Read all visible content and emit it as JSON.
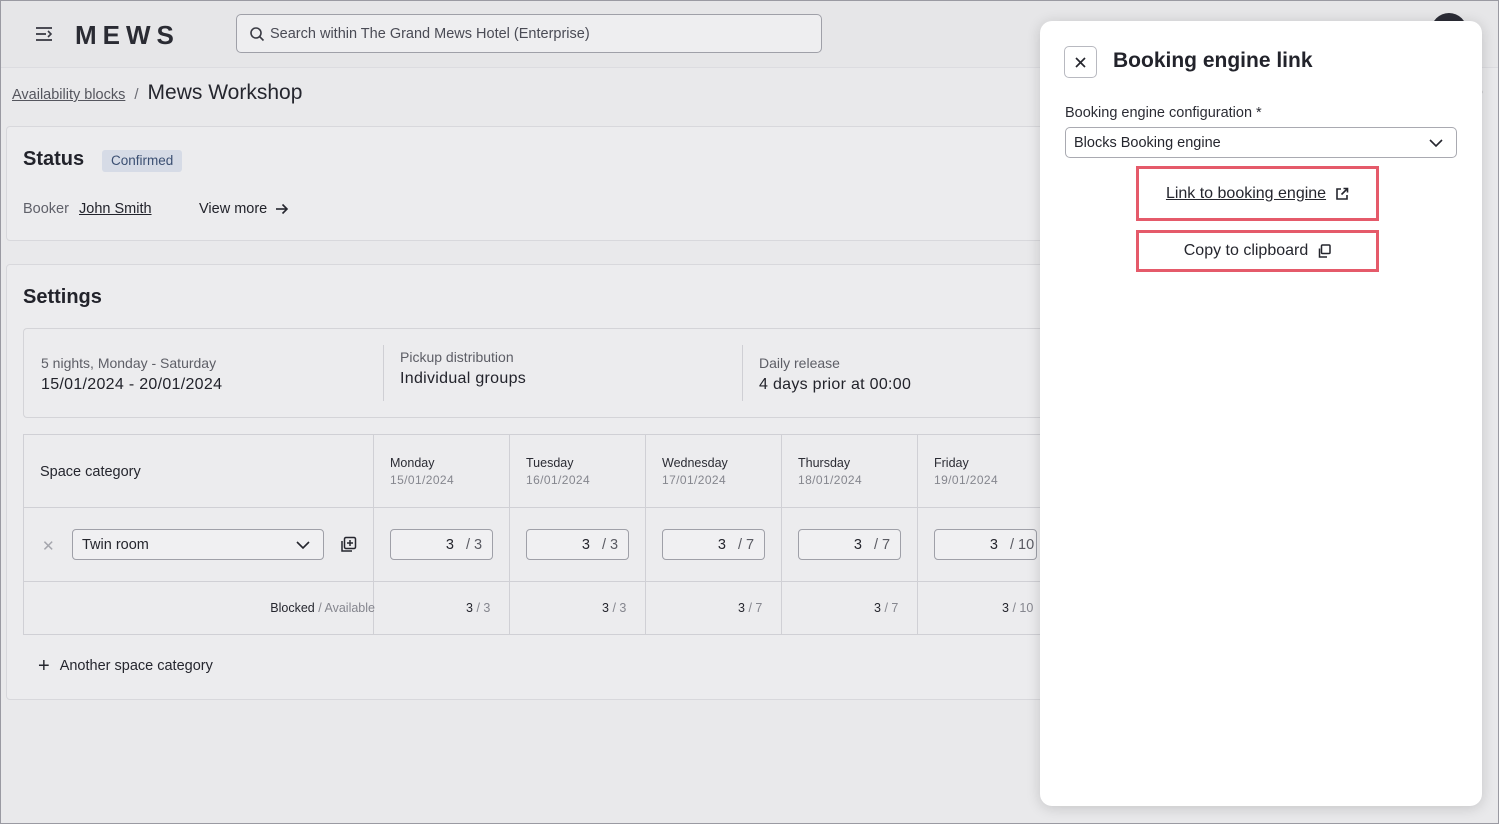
{
  "app": {
    "logo": "MEWS",
    "search_placeholder": "Search within The Grand Mews Hotel (Enterprise)"
  },
  "breadcrumb": {
    "parent": "Availability blocks",
    "separator": "/",
    "current": "Mews Workshop"
  },
  "status": {
    "title": "Status",
    "badge": "Confirmed",
    "booker_label": "Booker",
    "booker_name": "John Smith",
    "view_more": "View more"
  },
  "settings": {
    "title": "Settings",
    "summary": [
      {
        "label": "5 nights, Monday - Saturday",
        "value": "15/01/2024 - 20/01/2024"
      },
      {
        "label": "Pickup distribution",
        "value": "Individual groups"
      },
      {
        "label": "Daily release",
        "value": "4 days prior at 00:00"
      }
    ],
    "grid": {
      "space_category_header": "Space category",
      "days": [
        {
          "name": "Monday",
          "date": "15/01/2024",
          "blocked": "3",
          "available": "/ 3",
          "total_blocked": "3",
          "total_available": "/ 3"
        },
        {
          "name": "Tuesday",
          "date": "16/01/2024",
          "blocked": "3",
          "available": "/ 3",
          "total_blocked": "3",
          "total_available": "/ 3"
        },
        {
          "name": "Wednesday",
          "date": "17/01/2024",
          "blocked": "3",
          "available": "/ 7",
          "total_blocked": "3",
          "total_available": "/ 7"
        },
        {
          "name": "Thursday",
          "date": "18/01/2024",
          "blocked": "3",
          "available": "/ 7",
          "total_blocked": "3",
          "total_available": "/ 7"
        },
        {
          "name": "Friday",
          "date": "19/01/2024",
          "blocked": "3",
          "available": "/ 10",
          "total_blocked": "3",
          "total_available": "/ 10"
        }
      ],
      "row_category": "Twin room",
      "remove_symbol": "✕",
      "totals_label_blocked": "Blocked",
      "totals_label_available": "/ Available"
    },
    "add_category": "Another space category"
  },
  "panel": {
    "title": "Booking engine link",
    "config_label": "Booking engine configuration *",
    "config_value": "Blocks Booking engine",
    "link_label": "Link to booking engine",
    "copy_label": "Copy to clipboard"
  },
  "colors": {
    "highlight": "#e55a6a",
    "badge_bg": "#d6dbe6",
    "badge_text": "#3b4f72"
  },
  "icons": [
    "menu-icon",
    "search-icon",
    "arrow-right-icon",
    "chevron-down-icon",
    "duplicate-icon",
    "close-icon",
    "external-link-icon",
    "copy-icon",
    "plus-icon"
  ]
}
